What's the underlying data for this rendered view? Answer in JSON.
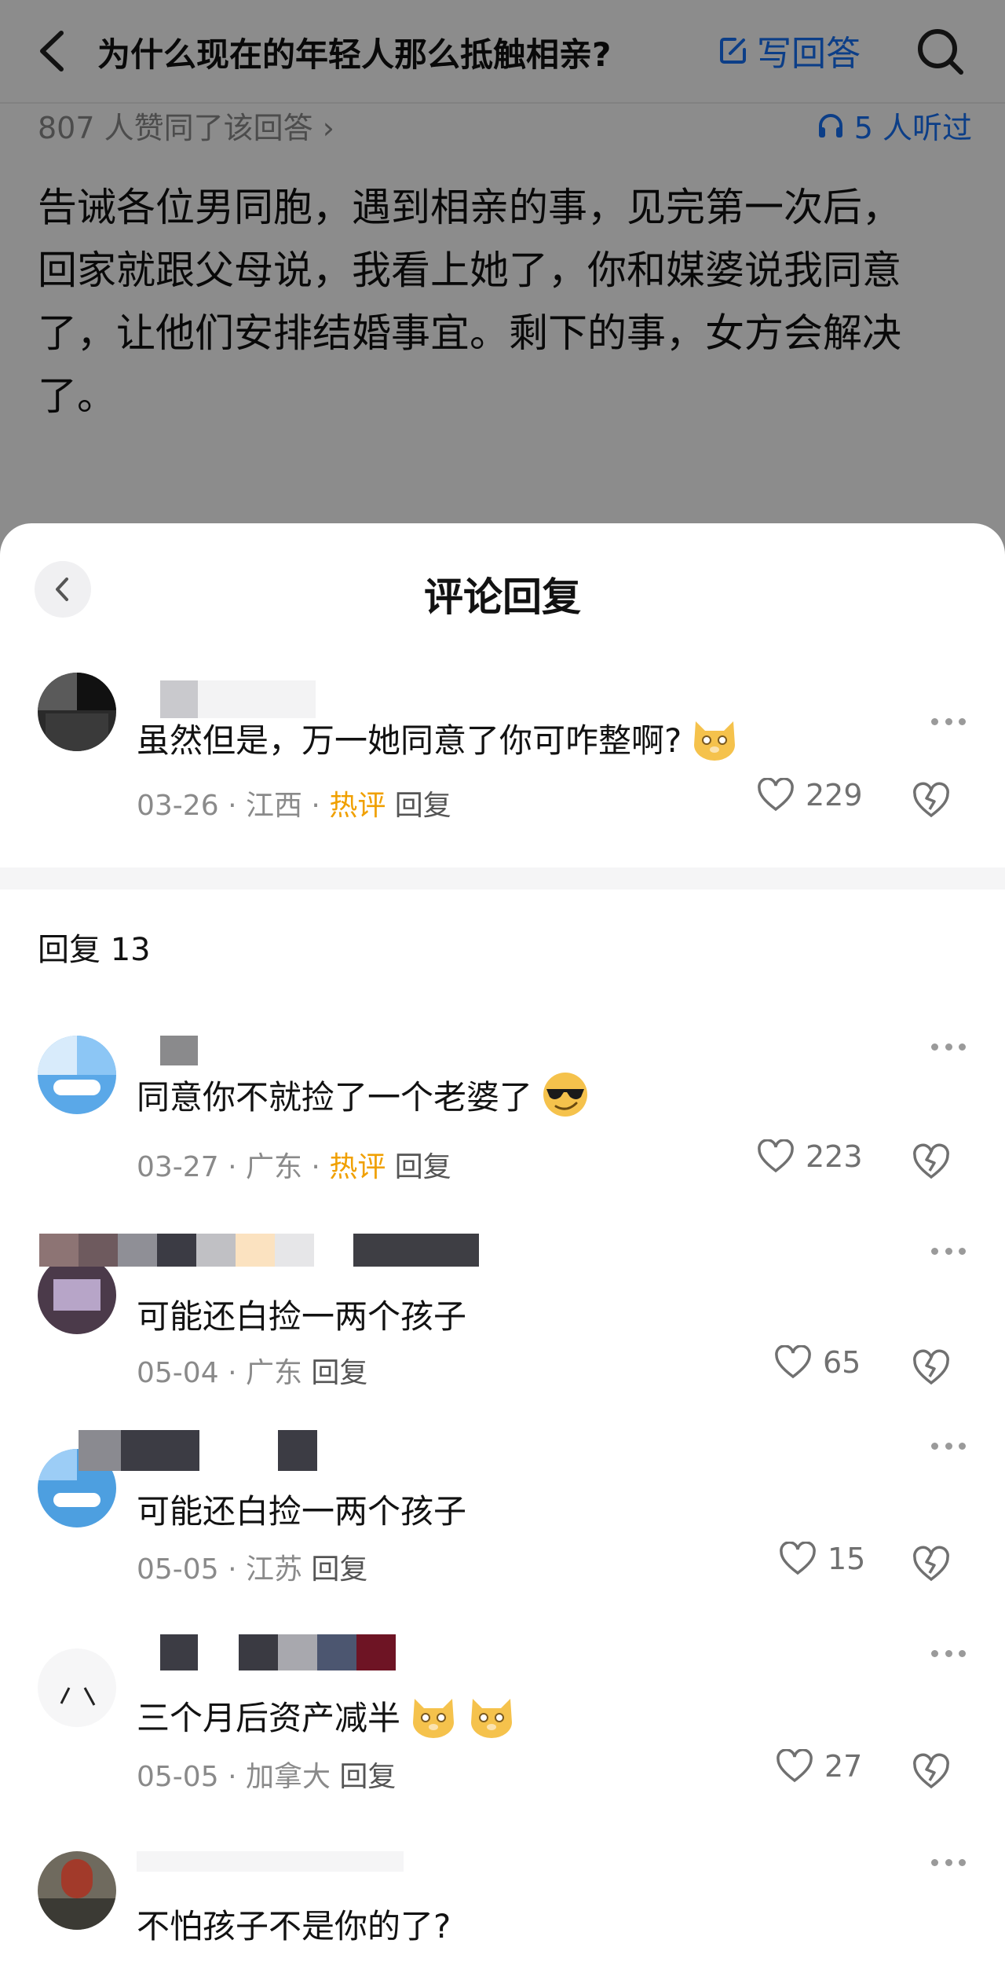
{
  "header": {
    "question_title": "为什么现在的年轻人那么抵触相亲?",
    "write_answer_label": "写回答"
  },
  "answer_meta": {
    "likes_text": "807 人赞同了该回答 ›",
    "listen_text": "5 人听过"
  },
  "answer": {
    "lines": [
      "告诫各位男同胞，遇到相亲的事，见完第一次后，",
      "回家就跟父母说，我看上她了，你和媒婆说我同意",
      "了，让他们安排结婚事宜。剩下的事，女方会解决",
      "了。"
    ]
  },
  "sheet": {
    "title": "评论回复"
  },
  "main_comment": {
    "text": "虽然但是，万一她同意了你可咋整啊?",
    "date": "03-26",
    "location": "江西",
    "badge": "热评",
    "reply_label": "回复",
    "likes": "229"
  },
  "replies_header": "回复 13",
  "replies": [
    {
      "text": "同意你不就捡了一个老婆了",
      "date": "03-27",
      "location": "广东",
      "badge": "热评",
      "reply_label": "回复",
      "likes": "223"
    },
    {
      "text": "可能还白捡一两个孩子",
      "date": "05-04",
      "location": "广东",
      "badge": "",
      "reply_label": "回复",
      "likes": "65"
    },
    {
      "text": "可能还白捡一两个孩子",
      "date": "05-05",
      "location": "江苏",
      "badge": "",
      "reply_label": "回复",
      "likes": "15"
    },
    {
      "text": "三个月后资产减半",
      "date": "05-05",
      "location": "加拿大",
      "badge": "",
      "reply_label": "回复",
      "likes": "27"
    },
    {
      "text": "不怕孩子不是你的了?",
      "date": "",
      "location": "",
      "badge": "",
      "reply_label": "",
      "likes": ""
    }
  ],
  "colors": {
    "accent_blue": "#1772f6",
    "hot_orange": "#f0a000",
    "overlay": "rgba(0,0,0,0.45)"
  },
  "icons": [
    "back-icon",
    "edit-icon",
    "search-icon",
    "headphones-icon",
    "more-icon",
    "heart-icon",
    "dislike-icon",
    "cat-emoji",
    "sunglasses-emoji"
  ]
}
